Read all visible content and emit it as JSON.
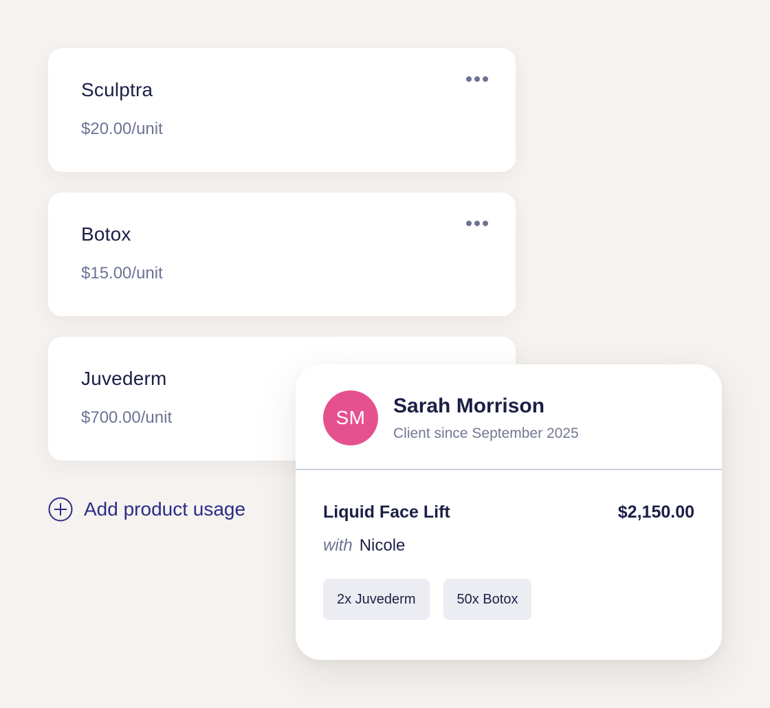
{
  "products": [
    {
      "name": "Sculptra",
      "price": "$20.00/unit",
      "has_menu": true
    },
    {
      "name": "Botox",
      "price": "$15.00/unit",
      "has_menu": true
    },
    {
      "name": "Juvederm",
      "price": "$700.00/unit",
      "has_menu": false
    }
  ],
  "add_usage": {
    "label": "Add product usage",
    "icon": "plus-circle-icon"
  },
  "client_card": {
    "avatar_initials": "SM",
    "avatar_color": "#e5518f",
    "client_name": "Sarah Morrison",
    "client_since": "Client since September 2025",
    "service_name": "Liquid Face Lift",
    "service_price": "$2,150.00",
    "provider_prefix": "with",
    "provider_name": "Nicole",
    "tags": [
      "2x Juvederm",
      "50x Botox"
    ]
  },
  "colors": {
    "background": "#f5f2f0",
    "accent": "#2b2c87",
    "text_primary": "#1c1f45",
    "text_secondary": "#6e7294"
  }
}
